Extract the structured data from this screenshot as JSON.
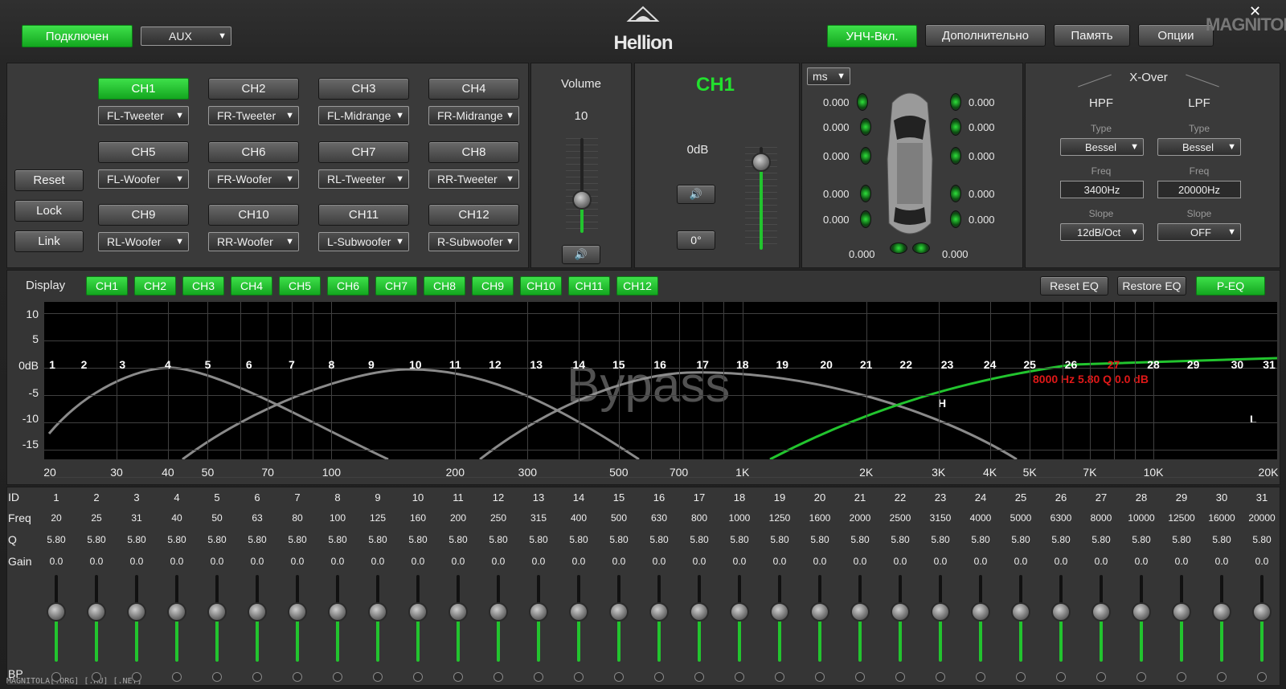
{
  "header": {
    "connected": "Подключен",
    "source": "AUX",
    "brand": "Hellion",
    "amp": "УНЧ-Вкл.",
    "extra": "Дополнительно",
    "memory": "Память",
    "options": "Опции",
    "logo": "MAGNITOLA",
    "close": "✕"
  },
  "channels": [
    {
      "name": "CH1",
      "assign": "FL-Tweeter"
    },
    {
      "name": "CH2",
      "assign": "FR-Tweeter"
    },
    {
      "name": "CH3",
      "assign": "FL-Midrange"
    },
    {
      "name": "CH4",
      "assign": "FR-Midrange"
    },
    {
      "name": "CH5",
      "assign": "FL-Woofer"
    },
    {
      "name": "CH6",
      "assign": "FR-Woofer"
    },
    {
      "name": "CH7",
      "assign": "RL-Tweeter"
    },
    {
      "name": "CH8",
      "assign": "RR-Tweeter"
    },
    {
      "name": "CH9",
      "assign": "RL-Woofer"
    },
    {
      "name": "CH10",
      "assign": "RR-Woofer"
    },
    {
      "name": "CH11",
      "assign": "L-Subwoofer"
    },
    {
      "name": "CH12",
      "assign": "R-Subwoofer"
    }
  ],
  "side_buttons": {
    "reset": "Reset",
    "lock": "Lock",
    "link": "Link"
  },
  "volume": {
    "label": "Volume",
    "value": "10",
    "level": 0.35
  },
  "channel_panel": {
    "title": "CH1",
    "gain": "0dB",
    "phase": "0°",
    "level": 0.85
  },
  "delay": {
    "unit": "ms",
    "left": [
      "0.000",
      "0.000",
      "0.000",
      "0.000",
      "0.000"
    ],
    "right": [
      "0.000",
      "0.000",
      "0.000",
      "0.000",
      "0.000"
    ],
    "bottom_left": "0.000",
    "bottom_right": "0.000"
  },
  "xover": {
    "title": "X-Over",
    "hpf": "HPF",
    "lpf": "LPF",
    "type_label": "Type",
    "freq_label": "Freq",
    "slope_label": "Slope",
    "hpf_type": "Bessel",
    "lpf_type": "Bessel",
    "hpf_freq": "3400Hz",
    "lpf_freq": "20000Hz",
    "hpf_slope": "12dB/Oct",
    "lpf_slope": "OFF"
  },
  "display": {
    "label": "Display",
    "channels": [
      "CH1",
      "CH2",
      "CH3",
      "CH4",
      "CH5",
      "CH6",
      "CH7",
      "CH8",
      "CH9",
      "CH10",
      "CH11",
      "CH12"
    ],
    "reset_eq": "Reset EQ",
    "restore_eq": "Restore EQ",
    "peq": "P-EQ"
  },
  "graph": {
    "overlay": "Bypass",
    "marker": "8000 Hz 5.80 Q 0.0 dB",
    "h_label": "H",
    "l_label": "L",
    "selected_band": "27",
    "y_ticks": [
      "10",
      "5",
      "0dB",
      "-5",
      "-10",
      "-15"
    ],
    "x_ticks": [
      "20",
      "30",
      "40",
      "50",
      "70",
      "100",
      "200",
      "300",
      "500",
      "700",
      "1K",
      "2K",
      "3K",
      "4K",
      "5K",
      "7K",
      "10K",
      "20K"
    ],
    "bands": [
      "1",
      "2",
      "3",
      "4",
      "5",
      "6",
      "7",
      "8",
      "9",
      "10",
      "11",
      "12",
      "13",
      "14",
      "15",
      "16",
      "17",
      "18",
      "19",
      "20",
      "21",
      "22",
      "23",
      "24",
      "25",
      "26",
      "27",
      "28",
      "29",
      "30",
      "31"
    ]
  },
  "table": {
    "row_labels": {
      "id": "ID",
      "freq": "Freq",
      "q": "Q",
      "gain": "Gain",
      "bp": "BP"
    },
    "ids": [
      "1",
      "2",
      "3",
      "4",
      "5",
      "6",
      "7",
      "8",
      "9",
      "10",
      "11",
      "12",
      "13",
      "14",
      "15",
      "16",
      "17",
      "18",
      "19",
      "20",
      "21",
      "22",
      "23",
      "24",
      "25",
      "26",
      "27",
      "28",
      "29",
      "30",
      "31"
    ],
    "freqs": [
      "20",
      "25",
      "31",
      "40",
      "50",
      "63",
      "80",
      "100",
      "125",
      "160",
      "200",
      "250",
      "315",
      "400",
      "500",
      "630",
      "800",
      "1000",
      "1250",
      "1600",
      "2000",
      "2500",
      "3150",
      "4000",
      "5000",
      "6300",
      "8000",
      "10000",
      "12500",
      "16000",
      "20000"
    ],
    "q": "5.80",
    "gain": "0.0"
  },
  "watermark": "MAGNITOLA[.ORG] [.RU] [.NET]",
  "colors": {
    "green": "#22c42e",
    "bg": "#3a3a3a",
    "marker": "#e01818"
  }
}
